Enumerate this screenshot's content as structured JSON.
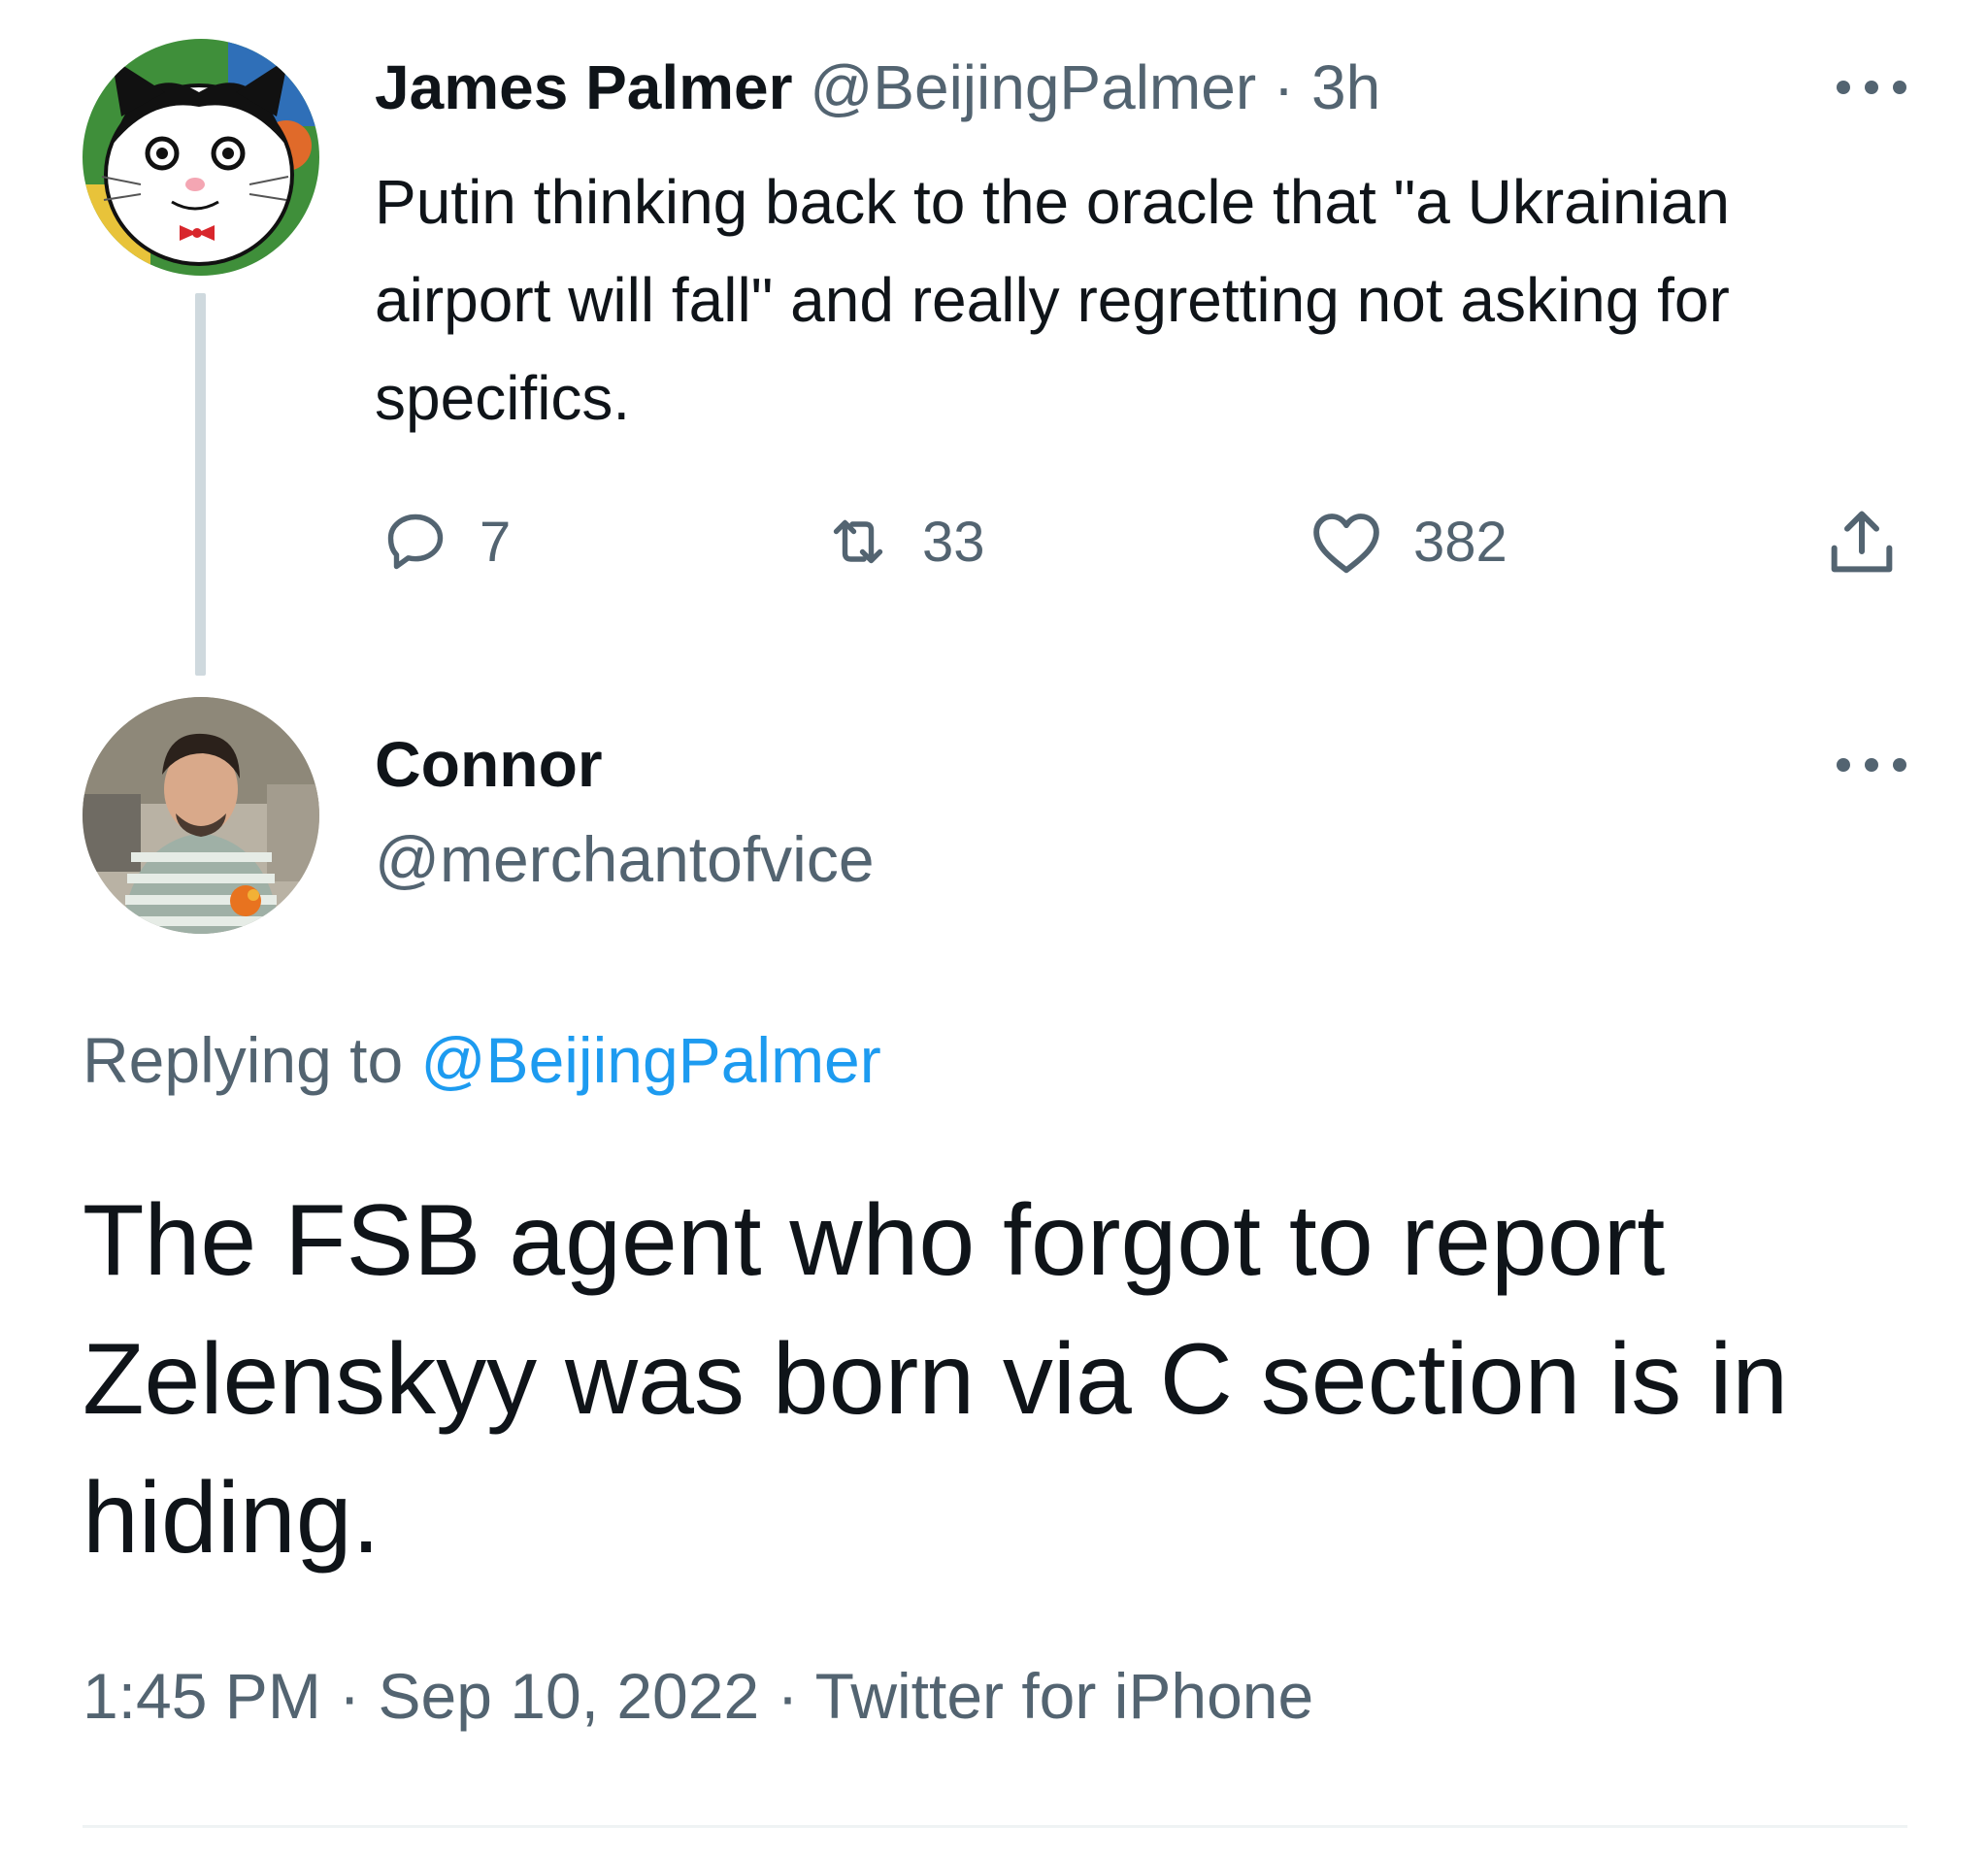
{
  "parent_tweet": {
    "author_name": "James Palmer",
    "author_handle": "@BeijingPalmer",
    "separator": "·",
    "time_ago": "3h",
    "text": "Putin thinking back to the oracle that \"a Ukrainian airport will fall\" and really regretting not asking for specifics.",
    "actions": {
      "reply_count": "7",
      "retweet_count": "33",
      "like_count": "382"
    },
    "icons": {
      "reply": "reply-icon",
      "retweet": "retweet-icon",
      "like": "heart-icon",
      "share": "share-icon",
      "more": "more-icon",
      "avatar": "cartoon-cat-avatar"
    }
  },
  "reply_tweet": {
    "author_name": "Connor",
    "author_handle": "@merchantofvice",
    "replying_to_prefix": "Replying to",
    "replying_to_handle": "@BeijingPalmer",
    "text": "The FSB agent who forgot to report Zelenskyy was born via C section is in hiding.",
    "meta": {
      "time": "1:45 PM",
      "date": "Sep 10, 2022",
      "source": "Twitter for iPhone",
      "separator": "·"
    },
    "icons": {
      "more": "more-icon",
      "avatar": "person-photo-avatar"
    }
  },
  "colors": {
    "text_primary": "#0f1419",
    "text_secondary": "#536471",
    "link": "#1d9bf0",
    "thread_line": "#cfd9de",
    "divider": "#eff3f4"
  }
}
